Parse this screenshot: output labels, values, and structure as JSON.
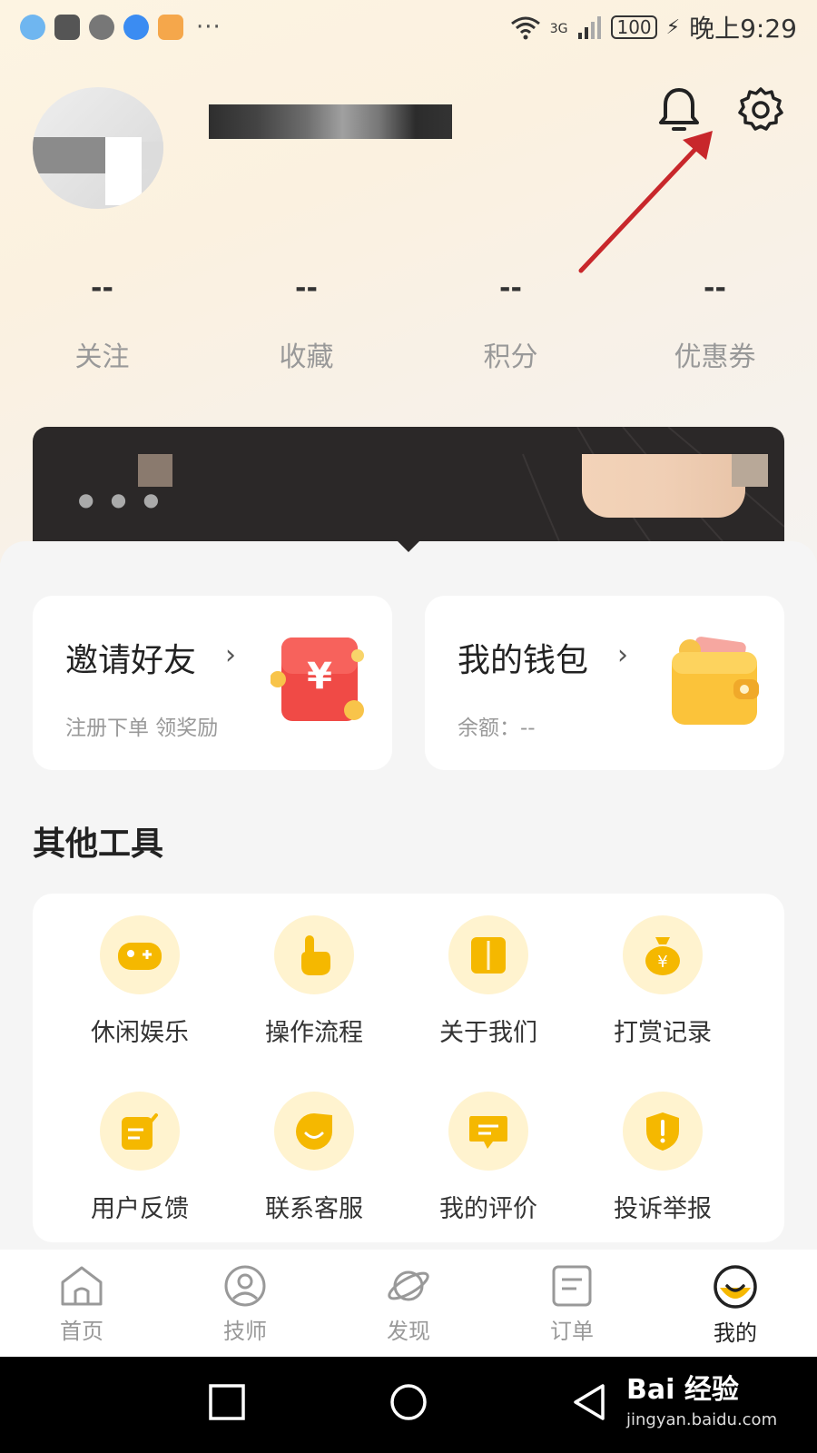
{
  "status_bar": {
    "network": "3G",
    "battery": "100",
    "time": "晚上9:29",
    "more": "···"
  },
  "stats": [
    {
      "value": "--",
      "label": "关注"
    },
    {
      "value": "--",
      "label": "收藏"
    },
    {
      "value": "--",
      "label": "积分"
    },
    {
      "value": "--",
      "label": "优惠券"
    }
  ],
  "cards": {
    "invite": {
      "title": "邀请好友",
      "subtitle": "注册下单 领奖励",
      "chevron": "›"
    },
    "wallet": {
      "title": "我的钱包",
      "subtitle": "余额：--",
      "chevron": "›"
    }
  },
  "tools_section": {
    "title": "其他工具",
    "items": [
      {
        "label": "休闲娱乐",
        "icon": "gamepad-icon"
      },
      {
        "label": "操作流程",
        "icon": "pointer-hand-icon"
      },
      {
        "label": "关于我们",
        "icon": "book-icon"
      },
      {
        "label": "打赏记录",
        "icon": "money-bag-icon"
      },
      {
        "label": "用户反馈",
        "icon": "edit-note-icon"
      },
      {
        "label": "联系客服",
        "icon": "smile-service-icon"
      },
      {
        "label": "我的评价",
        "icon": "comment-icon"
      },
      {
        "label": "投诉举报",
        "icon": "shield-alert-icon"
      }
    ]
  },
  "tabbar": [
    {
      "label": "首页",
      "icon": "home-icon"
    },
    {
      "label": "技师",
      "icon": "user-circle-icon"
    },
    {
      "label": "发现",
      "icon": "planet-icon"
    },
    {
      "label": "订单",
      "icon": "order-doc-icon"
    },
    {
      "label": "我的",
      "icon": "profile-smile-icon",
      "active": true
    }
  ],
  "watermark": {
    "brand": "Bai 经验",
    "url": "jingyan.baidu.com"
  },
  "colors": {
    "accent": "#f5b800",
    "icon_bg": "#fff3cf",
    "arrow": "#c8272b"
  }
}
